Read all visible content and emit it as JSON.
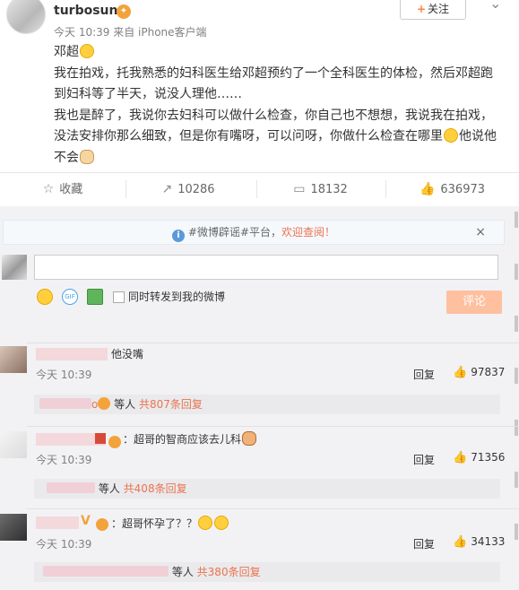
{
  "post": {
    "username": "turbosun",
    "follow_label": "关注",
    "meta": "今天 10:39 来自 iPhone客户端",
    "lines": [
      "邓超",
      "我在拍戏，托我熟悉的妇科医生给邓超预约了一个全科医生的体检，然后邓超跑",
      "到妇科等了半天，说没人理他……",
      "我也是醉了，我说你去妇科可以做什么检查，你自己也不想想，我说我在拍戏，",
      "没法安排你那么细致，但是你有嘴呀，可以问呀，你做什么检查在哪里",
      "他说他",
      "不会"
    ],
    "actions": {
      "favorite": "收藏",
      "repost_count": "10286",
      "comment_count": "18132",
      "like_count": "636973"
    }
  },
  "notice": {
    "prefix": "#微博辟谣#平台，",
    "highlight": "欢迎查阅！",
    "close": "×"
  },
  "composer": {
    "repost_label": "同时转发到我的微博",
    "submit_label": "评论",
    "gif_label": "GIF"
  },
  "comments": [
    {
      "text": "他没嘴",
      "time": "今天 10:39",
      "reply_label": "回复",
      "likes": "97837",
      "sub_user_tail": "o",
      "sub_suffix": "等人",
      "sub_count": "共807条回复"
    },
    {
      "text": "：超哥的智商应该去儿科",
      "time": "今天 10:39",
      "reply_label": "回复",
      "likes": "71356",
      "sub_suffix": "等人",
      "sub_count": "共408条回复"
    },
    {
      "text": "：超哥怀孕了？？",
      "time": "今天 10:39",
      "reply_label": "回复",
      "likes": "34133",
      "sub_suffix": "等人",
      "sub_count": "共380条回复"
    }
  ],
  "colors": {
    "accent": "#eb7350",
    "submit_disabled": "#ffc09f",
    "background": "#f2f2f5"
  }
}
